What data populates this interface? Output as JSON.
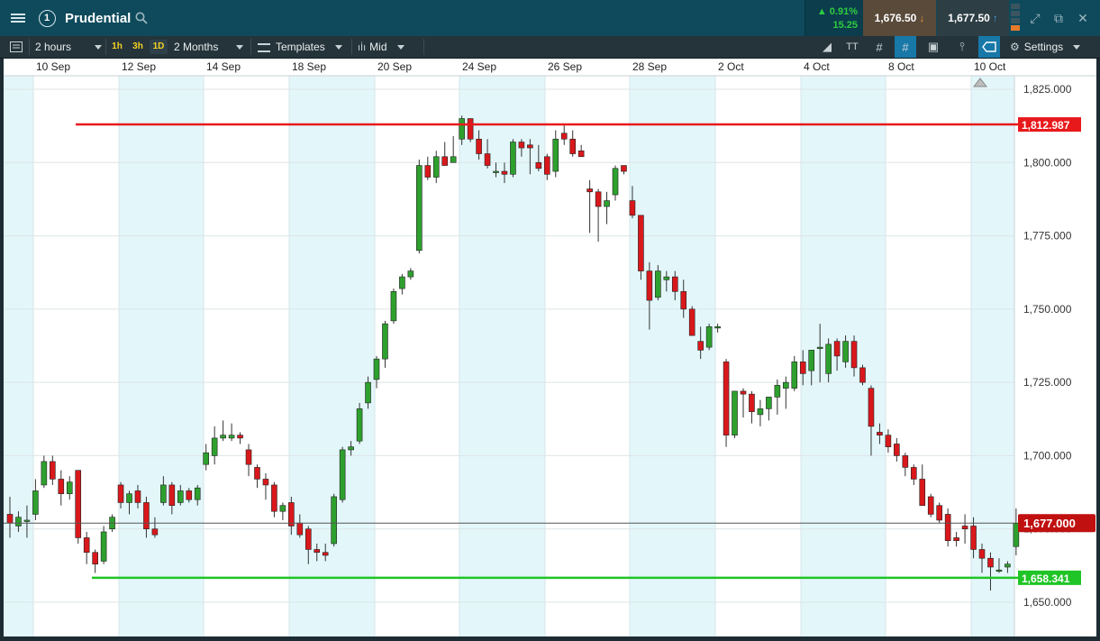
{
  "header": {
    "instrument": "Prudential",
    "change_pct": "0.91%",
    "change_abs": "15.25",
    "sell_price": "1,676.50",
    "buy_price": "1,677.50",
    "window_count": "1"
  },
  "toolbar": {
    "interval": "2 hours",
    "quick_intervals": [
      "1h",
      "3h",
      "1D"
    ],
    "range": "2 Months",
    "templates": "Templates",
    "price_type": "Mid",
    "settings": "Settings"
  },
  "chart_data": {
    "type": "candlestick",
    "instrument": "Prudential",
    "x_ticks": [
      "10 Sep",
      "12 Sep",
      "14 Sep",
      "18 Sep",
      "20 Sep",
      "24 Sep",
      "26 Sep",
      "28 Sep",
      "2 Oct",
      "4 Oct",
      "8 Oct",
      "10 Oct"
    ],
    "y_ticks": [
      "1,825.000",
      "1,800.000",
      "1,775.000",
      "1,750.000",
      "1,725.000",
      "1,700.000",
      "1,675.000",
      "1,650.000"
    ],
    "ylim": [
      1642,
      1830
    ],
    "horizontal_lines": [
      {
        "label": "1,812.987",
        "value": 1812.987,
        "color": "#e8191b"
      },
      {
        "label": "1,658.341",
        "value": 1658.341,
        "color": "#1fc426"
      }
    ],
    "current_price": {
      "label": "1,677.000",
      "value": 1677.0,
      "color": "#c01010"
    },
    "colors": {
      "up": "#2ea02e",
      "down": "#d9181c",
      "shade": "#e3f7fb"
    },
    "candles": [
      {
        "o": 1680,
        "h": 1686,
        "l": 1672,
        "c": 1677
      },
      {
        "o": 1676,
        "h": 1681,
        "l": 1674,
        "c": 1679
      },
      {
        "o": 1678,
        "h": 1683,
        "l": 1672,
        "c": 1678
      },
      {
        "o": 1680,
        "h": 1692,
        "l": 1678,
        "c": 1688
      },
      {
        "o": 1690,
        "h": 1700,
        "l": 1689,
        "c": 1698
      },
      {
        "o": 1698,
        "h": 1700,
        "l": 1690,
        "c": 1692
      },
      {
        "o": 1692,
        "h": 1695,
        "l": 1683,
        "c": 1687
      },
      {
        "o": 1687,
        "h": 1693,
        "l": 1685,
        "c": 1691
      },
      {
        "o": 1695,
        "h": 1695,
        "l": 1670,
        "c": 1672
      },
      {
        "o": 1672,
        "h": 1674,
        "l": 1663,
        "c": 1667
      },
      {
        "o": 1667,
        "h": 1668,
        "l": 1660,
        "c": 1663
      },
      {
        "o": 1664,
        "h": 1676,
        "l": 1663,
        "c": 1674
      },
      {
        "o": 1675,
        "h": 1680,
        "l": 1674,
        "c": 1679
      },
      {
        "o": 1690,
        "h": 1691,
        "l": 1682,
        "c": 1684
      },
      {
        "o": 1684,
        "h": 1688,
        "l": 1680,
        "c": 1687
      },
      {
        "o": 1688,
        "h": 1690,
        "l": 1682,
        "c": 1684
      },
      {
        "o": 1684,
        "h": 1686,
        "l": 1672,
        "c": 1675
      },
      {
        "o": 1675,
        "h": 1679,
        "l": 1672,
        "c": 1673
      },
      {
        "o": 1684,
        "h": 1693,
        "l": 1683,
        "c": 1690
      },
      {
        "o": 1690,
        "h": 1691,
        "l": 1680,
        "c": 1683
      },
      {
        "o": 1684,
        "h": 1690,
        "l": 1683,
        "c": 1688
      },
      {
        "o": 1688,
        "h": 1689,
        "l": 1684,
        "c": 1685
      },
      {
        "o": 1685,
        "h": 1690,
        "l": 1683,
        "c": 1689
      },
      {
        "o": 1697,
        "h": 1704,
        "l": 1695,
        "c": 1701
      },
      {
        "o": 1700,
        "h": 1710,
        "l": 1697,
        "c": 1706
      },
      {
        "o": 1706,
        "h": 1712,
        "l": 1705,
        "c": 1707
      },
      {
        "o": 1706,
        "h": 1711,
        "l": 1705,
        "c": 1707
      },
      {
        "o": 1707,
        "h": 1708,
        "l": 1704,
        "c": 1706
      },
      {
        "o": 1702,
        "h": 1704,
        "l": 1693,
        "c": 1697
      },
      {
        "o": 1696,
        "h": 1697,
        "l": 1689,
        "c": 1692
      },
      {
        "o": 1692,
        "h": 1694,
        "l": 1685,
        "c": 1690
      },
      {
        "o": 1690,
        "h": 1691,
        "l": 1679,
        "c": 1681
      },
      {
        "o": 1681,
        "h": 1684,
        "l": 1678,
        "c": 1683
      },
      {
        "o": 1684,
        "h": 1686,
        "l": 1673,
        "c": 1676
      },
      {
        "o": 1677,
        "h": 1680,
        "l": 1672,
        "c": 1673
      },
      {
        "o": 1675,
        "h": 1676,
        "l": 1663,
        "c": 1668
      },
      {
        "o": 1668,
        "h": 1670,
        "l": 1664,
        "c": 1667
      },
      {
        "o": 1667,
        "h": 1670,
        "l": 1664,
        "c": 1666
      },
      {
        "o": 1670,
        "h": 1687,
        "l": 1669,
        "c": 1686
      },
      {
        "o": 1685,
        "h": 1703,
        "l": 1684,
        "c": 1702
      },
      {
        "o": 1702,
        "h": 1705,
        "l": 1700,
        "c": 1703
      },
      {
        "o": 1705,
        "h": 1718,
        "l": 1704,
        "c": 1716
      },
      {
        "o": 1718,
        "h": 1727,
        "l": 1716,
        "c": 1725
      },
      {
        "o": 1726,
        "h": 1734,
        "l": 1723,
        "c": 1733
      },
      {
        "o": 1733,
        "h": 1746,
        "l": 1730,
        "c": 1745
      },
      {
        "o": 1746,
        "h": 1757,
        "l": 1745,
        "c": 1756
      },
      {
        "o": 1757,
        "h": 1762,
        "l": 1755,
        "c": 1761
      },
      {
        "o": 1761,
        "h": 1764,
        "l": 1760,
        "c": 1763
      },
      {
        "o": 1770,
        "h": 1801,
        "l": 1769,
        "c": 1799
      },
      {
        "o": 1799,
        "h": 1802,
        "l": 1794,
        "c": 1795
      },
      {
        "o": 1795,
        "h": 1804,
        "l": 1793,
        "c": 1802
      },
      {
        "o": 1802,
        "h": 1807,
        "l": 1799,
        "c": 1799
      },
      {
        "o": 1800,
        "h": 1809,
        "l": 1800,
        "c": 1802
      },
      {
        "o": 1808,
        "h": 1816,
        "l": 1806,
        "c": 1815
      },
      {
        "o": 1815,
        "h": 1815,
        "l": 1807,
        "c": 1808
      },
      {
        "o": 1808,
        "h": 1811,
        "l": 1801,
        "c": 1803
      },
      {
        "o": 1803,
        "h": 1808,
        "l": 1798,
        "c": 1799
      },
      {
        "o": 1797,
        "h": 1800,
        "l": 1795,
        "c": 1797
      },
      {
        "o": 1797,
        "h": 1800,
        "l": 1793,
        "c": 1796
      },
      {
        "o": 1796,
        "h": 1808,
        "l": 1795,
        "c": 1807
      },
      {
        "o": 1807,
        "h": 1808,
        "l": 1802,
        "c": 1805
      },
      {
        "o": 1806,
        "h": 1808,
        "l": 1796,
        "c": 1805
      },
      {
        "o": 1800,
        "h": 1806,
        "l": 1797,
        "c": 1798
      },
      {
        "o": 1802,
        "h": 1803,
        "l": 1794,
        "c": 1796
      },
      {
        "o": 1797,
        "h": 1811,
        "l": 1795,
        "c": 1808
      },
      {
        "o": 1810,
        "h": 1813,
        "l": 1806,
        "c": 1808
      },
      {
        "o": 1808,
        "h": 1811,
        "l": 1802,
        "c": 1803
      },
      {
        "o": 1804,
        "h": 1806,
        "l": 1802,
        "c": 1802
      },
      {
        "o": 1791,
        "h": 1794,
        "l": 1776,
        "c": 1790
      },
      {
        "o": 1790,
        "h": 1791,
        "l": 1773,
        "c": 1785
      },
      {
        "o": 1785,
        "h": 1790,
        "l": 1779,
        "c": 1787
      },
      {
        "o": 1789,
        "h": 1799,
        "l": 1787,
        "c": 1798
      },
      {
        "o": 1799,
        "h": 1799,
        "l": 1796,
        "c": 1797
      },
      {
        "o": 1787,
        "h": 1792,
        "l": 1781,
        "c": 1782
      },
      {
        "o": 1782,
        "h": 1782,
        "l": 1760,
        "c": 1763
      },
      {
        "o": 1763,
        "h": 1766,
        "l": 1743,
        "c": 1753
      },
      {
        "o": 1754,
        "h": 1765,
        "l": 1753,
        "c": 1763
      },
      {
        "o": 1760,
        "h": 1763,
        "l": 1756,
        "c": 1761
      },
      {
        "o": 1761,
        "h": 1763,
        "l": 1753,
        "c": 1756
      },
      {
        "o": 1756,
        "h": 1760,
        "l": 1747,
        "c": 1750
      },
      {
        "o": 1750,
        "h": 1751,
        "l": 1741,
        "c": 1741
      },
      {
        "o": 1739,
        "h": 1744,
        "l": 1733,
        "c": 1736
      },
      {
        "o": 1737,
        "h": 1745,
        "l": 1736,
        "c": 1744
      },
      {
        "o": 1744,
        "h": 1745,
        "l": 1742,
        "c": 1744
      },
      {
        "o": 1732,
        "h": 1733,
        "l": 1703,
        "c": 1707
      },
      {
        "o": 1707,
        "h": 1722,
        "l": 1706,
        "c": 1722
      },
      {
        "o": 1722,
        "h": 1723,
        "l": 1713,
        "c": 1721
      },
      {
        "o": 1721,
        "h": 1722,
        "l": 1711,
        "c": 1715
      },
      {
        "o": 1714,
        "h": 1719,
        "l": 1710,
        "c": 1716
      },
      {
        "o": 1716,
        "h": 1719,
        "l": 1712,
        "c": 1720
      },
      {
        "o": 1720,
        "h": 1726,
        "l": 1714,
        "c": 1724
      },
      {
        "o": 1723,
        "h": 1727,
        "l": 1716,
        "c": 1725
      },
      {
        "o": 1723,
        "h": 1734,
        "l": 1722,
        "c": 1732
      },
      {
        "o": 1732,
        "h": 1736,
        "l": 1724,
        "c": 1728
      },
      {
        "o": 1729,
        "h": 1733,
        "l": 1724,
        "c": 1736
      },
      {
        "o": 1737,
        "h": 1745,
        "l": 1725,
        "c": 1737
      },
      {
        "o": 1728,
        "h": 1740,
        "l": 1725,
        "c": 1738
      },
      {
        "o": 1739,
        "h": 1740,
        "l": 1729,
        "c": 1734
      },
      {
        "o": 1732,
        "h": 1741,
        "l": 1730,
        "c": 1739
      },
      {
        "o": 1739,
        "h": 1741,
        "l": 1727,
        "c": 1730
      },
      {
        "o": 1730,
        "h": 1731,
        "l": 1724,
        "c": 1725
      },
      {
        "o": 1723,
        "h": 1724,
        "l": 1700,
        "c": 1710
      },
      {
        "o": 1708,
        "h": 1711,
        "l": 1704,
        "c": 1707
      },
      {
        "o": 1707,
        "h": 1709,
        "l": 1701,
        "c": 1703
      },
      {
        "o": 1704,
        "h": 1706,
        "l": 1698,
        "c": 1700
      },
      {
        "o": 1700,
        "h": 1701,
        "l": 1693,
        "c": 1696
      },
      {
        "o": 1696,
        "h": 1697,
        "l": 1690,
        "c": 1692
      },
      {
        "o": 1692,
        "h": 1697,
        "l": 1683,
        "c": 1683
      },
      {
        "o": 1686,
        "h": 1687,
        "l": 1679,
        "c": 1680
      },
      {
        "o": 1683,
        "h": 1684,
        "l": 1677,
        "c": 1678
      },
      {
        "o": 1680,
        "h": 1682,
        "l": 1669,
        "c": 1671
      },
      {
        "o": 1672,
        "h": 1674,
        "l": 1669,
        "c": 1671
      },
      {
        "o": 1676,
        "h": 1680,
        "l": 1670,
        "c": 1675
      },
      {
        "o": 1676,
        "h": 1679,
        "l": 1665,
        "c": 1668
      },
      {
        "o": 1668,
        "h": 1670,
        "l": 1660,
        "c": 1665
      },
      {
        "o": 1665,
        "h": 1667,
        "l": 1654,
        "c": 1662
      },
      {
        "o": 1661,
        "h": 1665,
        "l": 1660,
        "c": 1661
      },
      {
        "o": 1662,
        "h": 1664,
        "l": 1660,
        "c": 1663
      },
      {
        "o": 1669,
        "h": 1682,
        "l": 1666,
        "c": 1677
      }
    ]
  }
}
